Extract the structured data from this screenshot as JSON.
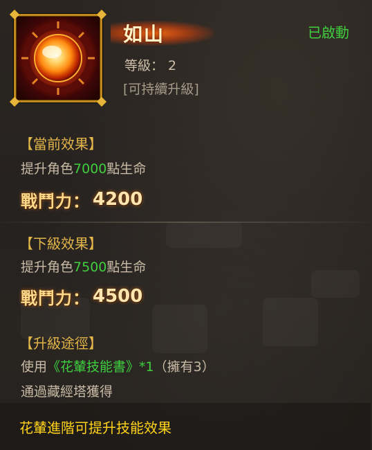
{
  "skill": {
    "title": "如山",
    "status": "已啟動",
    "level_label": "等級：",
    "level_value": "2",
    "upgrade_note": "[可持續升級]"
  },
  "current_effect": {
    "header": "【當前效果】",
    "desc_prefix": "提升角色",
    "value": "7000",
    "desc_suffix": "點生命",
    "power_label": "戰鬥力：",
    "power_value": "4200"
  },
  "next_effect": {
    "header": "【下級效果】",
    "desc_prefix": "提升角色",
    "value": "7500",
    "desc_suffix": "點生命",
    "power_label": "戰鬥力：",
    "power_value": "4500"
  },
  "upgrade_path": {
    "header": "【升級途徑】",
    "use_prefix": "使用",
    "item_name": "《花輦技能書》*1",
    "owned": "（擁有3）",
    "source": "通過藏經塔獲得"
  },
  "footer": {
    "tip": "花輦進階可提升技能效果"
  },
  "icon": {
    "name": "sun-orb-icon"
  },
  "colors": {
    "green": "#3fcf3f",
    "gold_header": "#e3b54a",
    "footer_yellow": "#ffd21a",
    "title_glow": "#ff6e14"
  }
}
